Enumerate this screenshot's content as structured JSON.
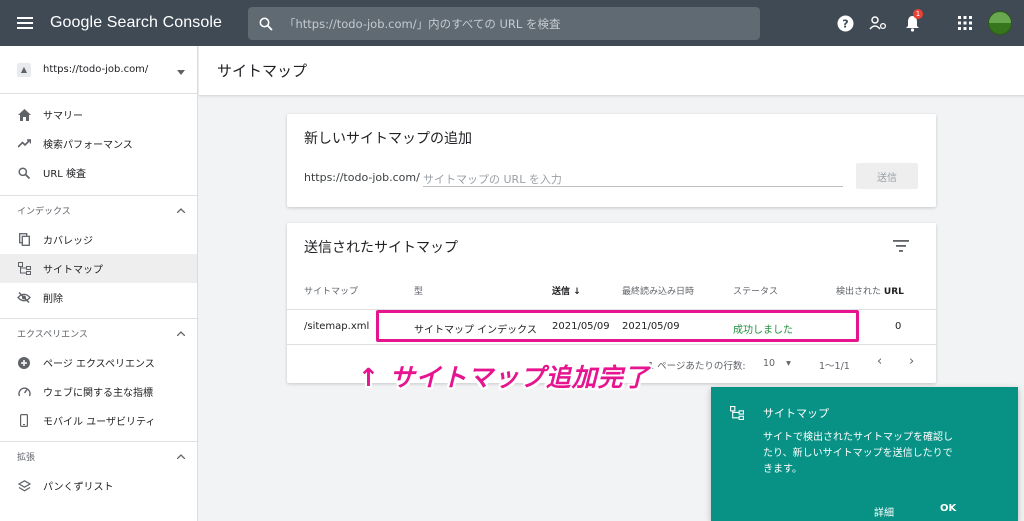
{
  "app": {
    "title": "Google Search Console"
  },
  "search": {
    "placeholder": "「https://todo-job.com/」内のすべての URL を検査"
  },
  "notifications": {
    "count": "1"
  },
  "sidebar": {
    "property": "https://todo-job.com/",
    "items": [
      {
        "label": "サマリー",
        "icon": "home-icon"
      },
      {
        "label": "検索パフォーマンス",
        "icon": "trending-up-icon"
      },
      {
        "label": "URL 検査",
        "icon": "search-icon"
      }
    ],
    "groups": [
      {
        "header": "インデックス",
        "items": [
          {
            "label": "カバレッジ",
            "icon": "copy-icon"
          },
          {
            "label": "サイトマップ",
            "icon": "sitemap-icon"
          },
          {
            "label": "削除",
            "icon": "eye-off-icon"
          }
        ]
      },
      {
        "header": "エクスペリエンス",
        "items": [
          {
            "label": "ページ エクスペリエンス",
            "icon": "add-circle-icon"
          },
          {
            "label": "ウェブに関する主な指標",
            "icon": "speed-icon"
          },
          {
            "label": "モバイル ユーザビリティ",
            "icon": "phone-icon"
          }
        ]
      },
      {
        "header": "拡張",
        "items": [
          {
            "label": "パンくずリスト",
            "icon": "layers-icon"
          }
        ]
      }
    ]
  },
  "page": {
    "title": "サイトマップ"
  },
  "add_card": {
    "title": "新しいサイトマップの追加",
    "url_prefix": "https://todo-job.com/",
    "input_placeholder": "サイトマップの URL を入力",
    "submit_label": "送信"
  },
  "submitted_card": {
    "title": "送信されたサイトマップ",
    "columns": [
      "サイトマップ",
      "型",
      "送信",
      "最終読み込み日時",
      "ステータス",
      "検出された",
      "URL"
    ],
    "rows": [
      {
        "sitemap": "/sitemap.xml",
        "type": "サイトマップ インデックス",
        "submitted": "2021/05/09",
        "last_read": "2021/05/09",
        "status": "成功しました",
        "urls": "0"
      }
    ],
    "pagination": {
      "rows_per_page_label": "1 ページあたりの行数:",
      "rows_per_page": "10",
      "range": "1〜1/1"
    }
  },
  "annotation": {
    "text": "↑ サイトマップ追加完了",
    "color": "#e6148f"
  },
  "snackbar": {
    "title": "サイトマップ",
    "body": "サイトで検出されたサイトマップを確認したり、新しいサイトマップを送信したりできます。",
    "detail_label": "詳細",
    "ok_label": "OK",
    "background": "#079285"
  }
}
